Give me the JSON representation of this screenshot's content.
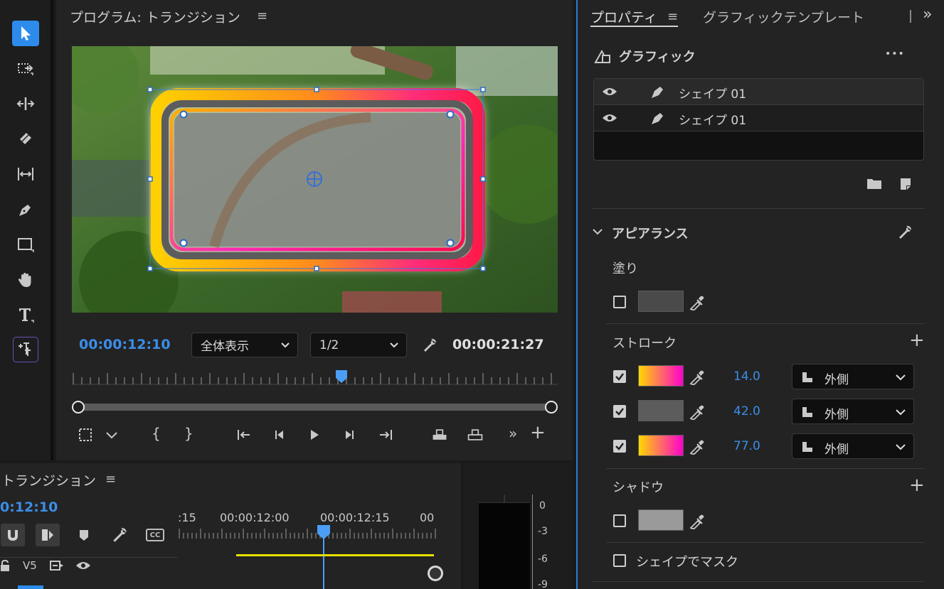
{
  "tools": [
    {
      "name": "selection-tool-icon"
    },
    {
      "name": "track-select-tool-icon"
    },
    {
      "name": "ripple-edit-tool-icon"
    },
    {
      "name": "razor-tool-icon"
    },
    {
      "name": "slip-tool-icon"
    },
    {
      "name": "pen-tool-icon"
    },
    {
      "name": "rectangle-tool-icon"
    },
    {
      "name": "hand-tool-icon"
    },
    {
      "name": "type-tool-icon"
    },
    {
      "name": "vertical-type-tool-icon"
    }
  ],
  "program": {
    "title": "プログラム: トランジション",
    "menu": "≡",
    "current_tc": "00:00:12:10",
    "zoom": "全体表示",
    "resolution": "1/2",
    "duration_tc": "00:00:21:27",
    "in_bracket": "{",
    "out_bracket": "}",
    "more": "»",
    "add": "+"
  },
  "timeline": {
    "title": "トランジション",
    "menu": "≡",
    "current_tc": "0:12:10",
    "ruler_labels": [
      ":15",
      "00:00:12:00",
      "00:00:12:15",
      "00"
    ],
    "track_label": "V5",
    "cc": "CC"
  },
  "meters": {
    "scale": [
      "0",
      "-3",
      "-6",
      "-9"
    ]
  },
  "props": {
    "tab_active": "プロパティ",
    "tab_menu": "≡",
    "tab_other": "グラフィックテンプレート",
    "overflow": "»",
    "graphic_title": "グラフィック",
    "more": "•••",
    "layers": [
      {
        "name": "シェイプ 01"
      },
      {
        "name": "シェイプ 01"
      }
    ],
    "appearance_title": "アピアランス",
    "fill_label": "塗り",
    "fill_color": "#4a4a4a",
    "stroke_label": "ストローク",
    "add": "+",
    "strokes": [
      {
        "width": "14.0",
        "position": "外側",
        "checked": true
      },
      {
        "width": "42.0",
        "position": "外側",
        "checked": true
      },
      {
        "width": "77.0",
        "position": "外側",
        "checked": true
      }
    ],
    "stroke2_color": "#5c5c5c",
    "shadow_label": "シャドウ",
    "shadow_color": "#9a9a9a",
    "mask_label": "シェイプでマスク"
  },
  "colors": {
    "accent": "#2d8ceb",
    "timecode": "#3b8ee8",
    "playhead": "#4a9ef5"
  }
}
